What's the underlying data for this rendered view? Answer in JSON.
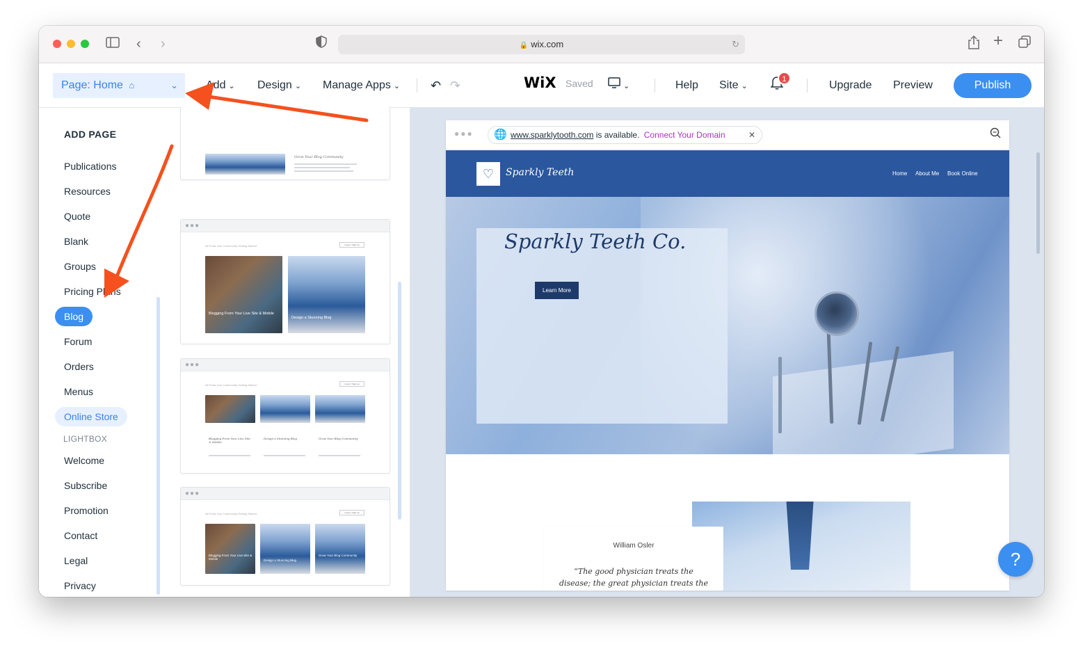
{
  "browser": {
    "url": "wix.com"
  },
  "editor": {
    "page_selector": "Page: Home",
    "menu": {
      "add": "Add",
      "design": "Design",
      "manage_apps": "Manage Apps",
      "help": "Help",
      "site": "Site",
      "upgrade": "Upgrade",
      "preview": "Preview",
      "publish": "Publish"
    },
    "logo": "WiX",
    "saved_status": "Saved",
    "notification_count": "1"
  },
  "add_page_panel": {
    "title": "ADD PAGE",
    "help": "?",
    "categories": [
      "Publications",
      "Resources",
      "Quote",
      "Blank",
      "Groups",
      "Pricing Plans",
      "Blog",
      "Forum",
      "Orders",
      "Menus",
      "Online Store"
    ],
    "active_category": "Blog",
    "highlighted_category": "Online Store",
    "lightbox_label": "LIGHTBOX",
    "lightbox_items": [
      "Welcome",
      "Subscribe",
      "Promotion",
      "Contact",
      "Legal",
      "Privacy"
    ],
    "thumbnails": {
      "t1_title": "Grow Your Blog Community",
      "t2_post1": "Blogging From Your Live Site & Mobile",
      "t2_post2": "Design a Stunning Blog",
      "t3_post1": "Blogging From Your Live Site & Mobile",
      "t3_post2": "Design a Stunning Blog",
      "t3_post3": "Grow Your Blog Community",
      "t4_post1": "Blogging From Your Live Site & Mobile",
      "t4_post2": "Design a Stunning Blog",
      "t4_post3": "Grow Your Blog Community",
      "login": "Log In / Sign up",
      "tabs": "All Posts   Your Community   Getting Started"
    }
  },
  "site_preview": {
    "domain": "www.sparklytooth.com",
    "domain_available": "is available.",
    "connect_domain": "Connect Your Domain",
    "site_name": "Sparkly Teeth",
    "nav": [
      "Home",
      "About Me",
      "Book Online"
    ],
    "hero_title": "Sparkly Teeth Co.",
    "hero_button": "Learn More",
    "quote_author": "William Osler",
    "quote_text": "“The good physician treats the disease; the great physician treats the"
  },
  "help_fab": "?",
  "colors": {
    "accent": "#3b8ff0",
    "site_header": "#2b579e",
    "annotation_arrow": "#f4511e"
  }
}
